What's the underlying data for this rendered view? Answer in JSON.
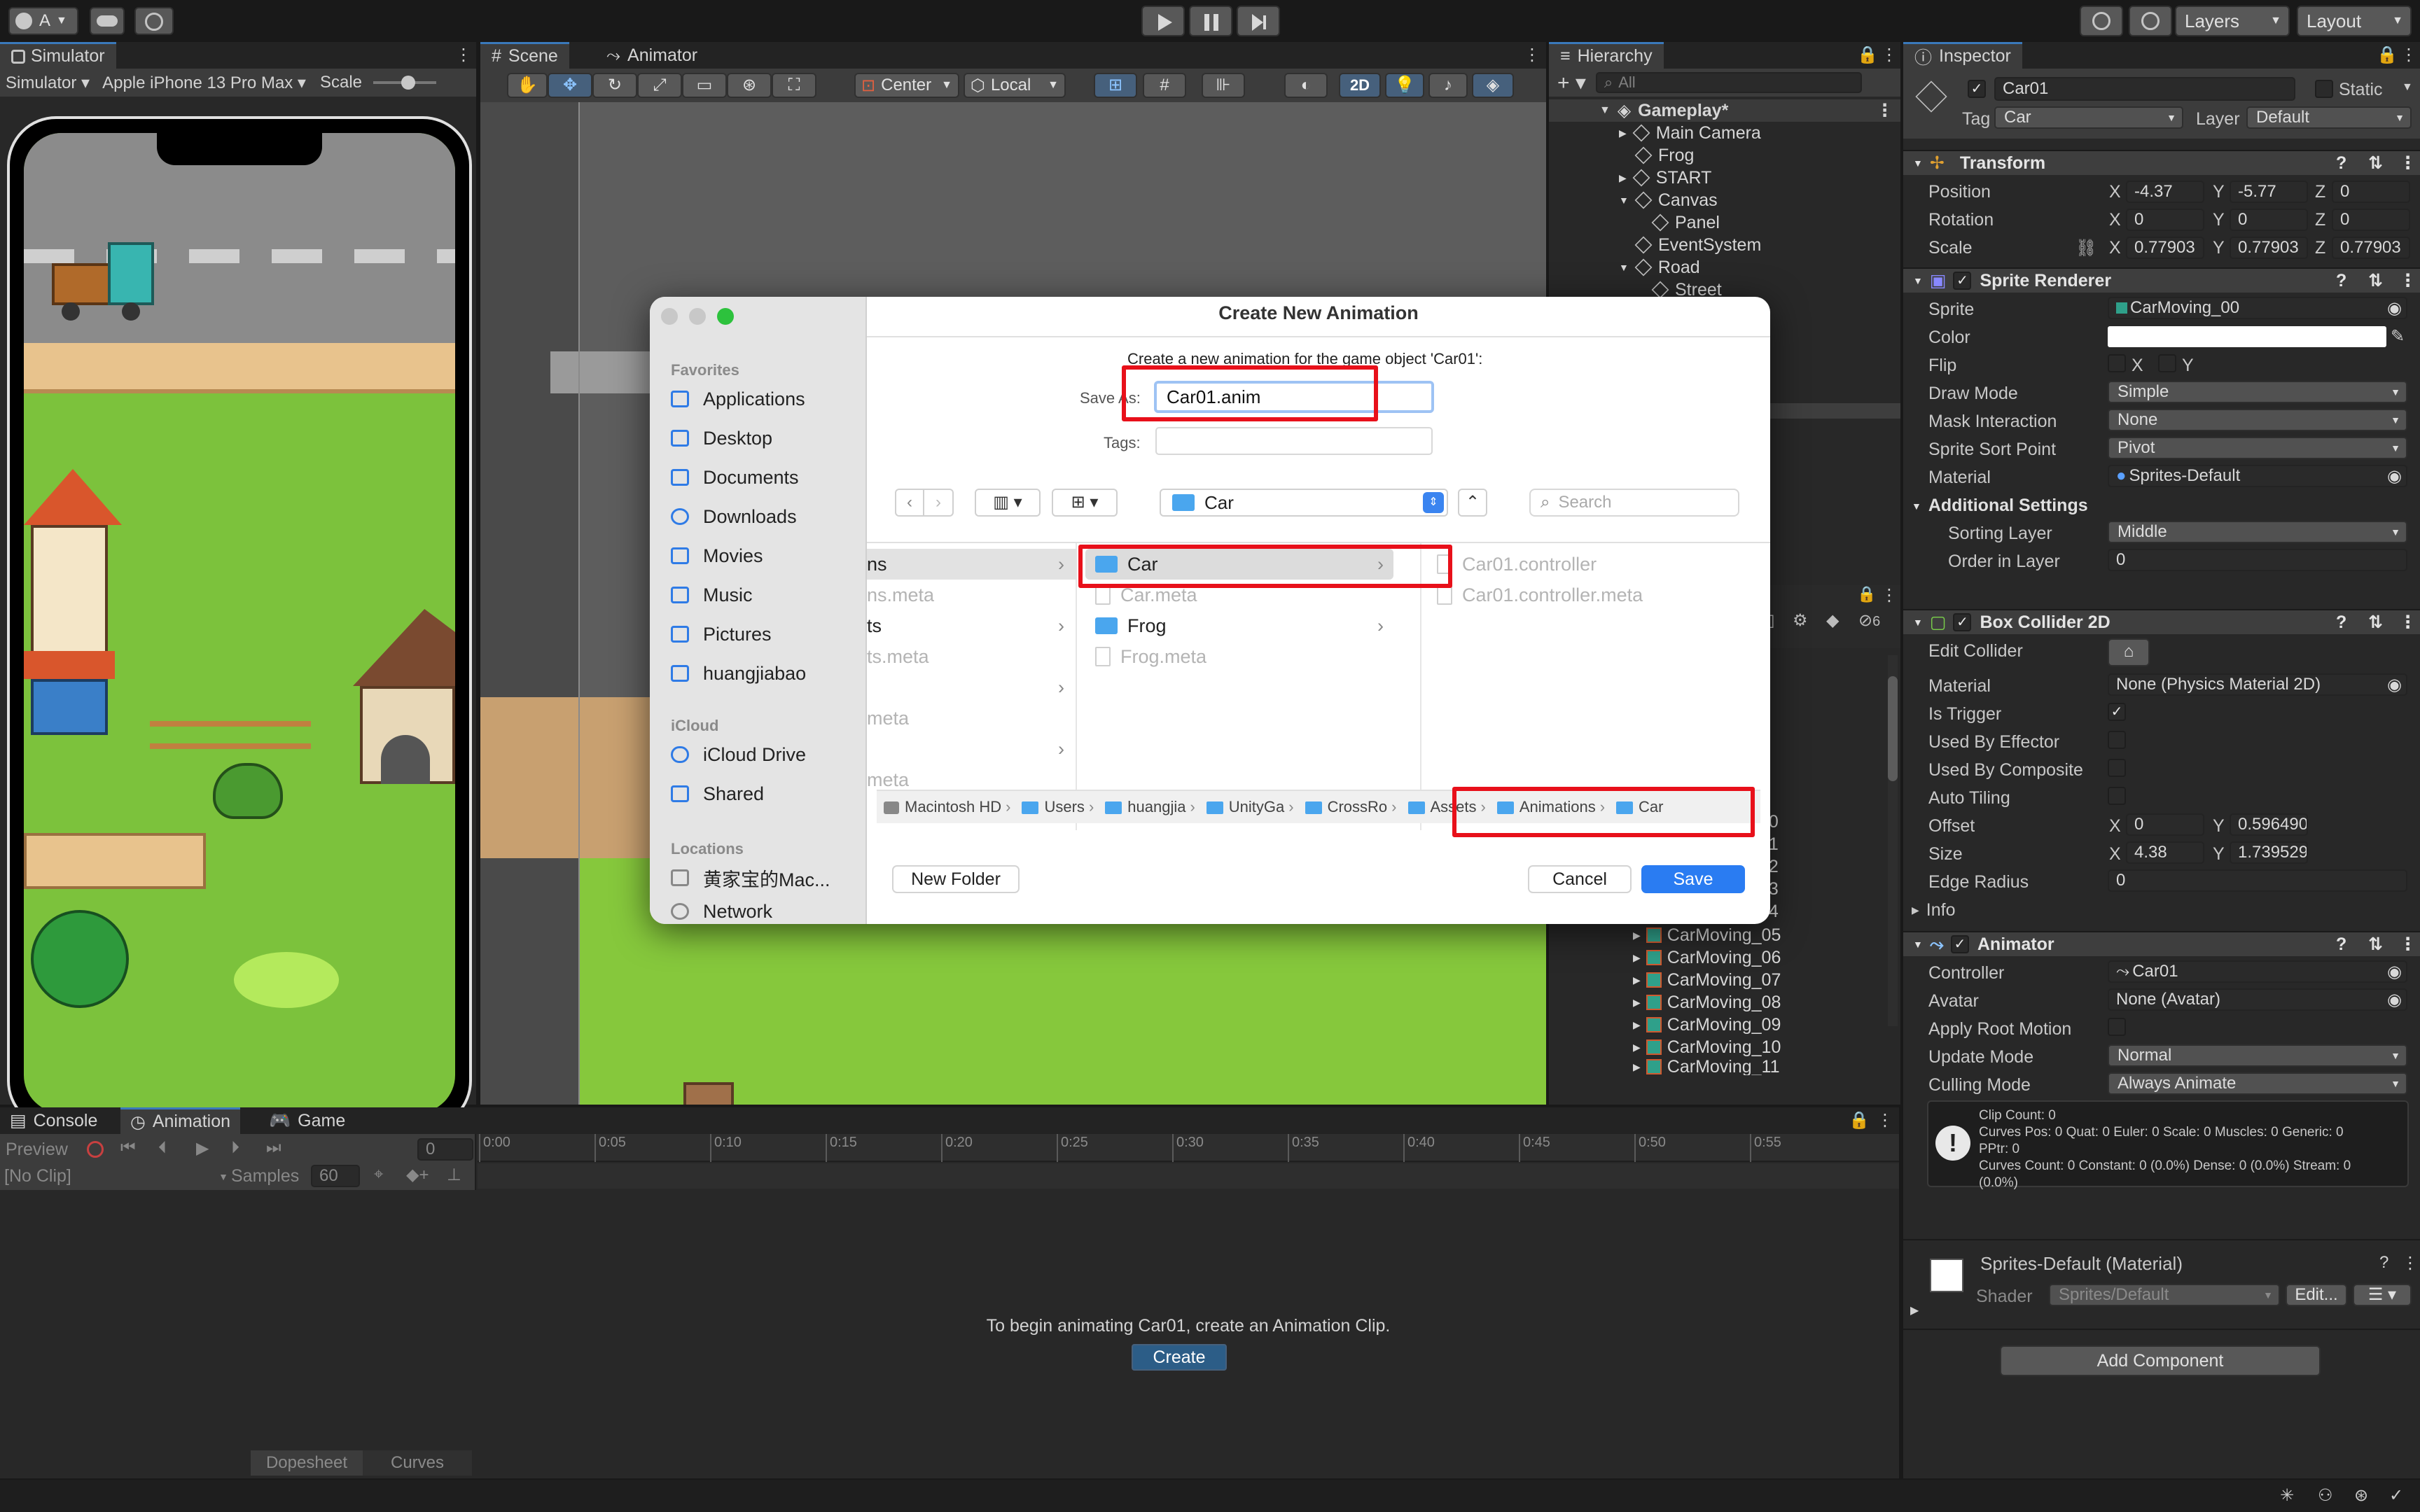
{
  "topbar": {
    "account": "A",
    "layers": "Layers",
    "layout": "Layout"
  },
  "simulator": {
    "tab": "Simulator",
    "mode": "Simulator",
    "device": "Apple iPhone 13 Pro Max",
    "scale_label": "Scale"
  },
  "scene": {
    "tab_scene": "Scene",
    "tab_animator": "Animator",
    "pivot": "Center",
    "space": "Local",
    "mode_2d": "2D"
  },
  "hierarchy": {
    "tab": "Hierarchy",
    "search_placeholder": "All",
    "root": "Gameplay*",
    "items": [
      "Main Camera",
      "Frog",
      "START",
      "Canvas",
      "Panel",
      "EventSystem",
      "Road",
      "Street"
    ],
    "carmoving": [
      "CarMoving_05",
      "CarMoving_06",
      "CarMoving_07",
      "CarMoving_08",
      "CarMoving_09",
      "CarMoving_10",
      "CarMoving_11"
    ],
    "partial": [
      "00",
      "01",
      "02",
      "03",
      "04"
    ],
    "hidden_count": "6"
  },
  "inspector": {
    "tab": "Inspector",
    "name": "Car01",
    "static": "Static",
    "tag_label": "Tag",
    "tag": "Car",
    "layer_label": "Layer",
    "layer": "Default",
    "transform": {
      "title": "Transform",
      "position": "Position",
      "rotation": "Rotation",
      "scale": "Scale",
      "px": "-4.37",
      "py": "-5.77",
      "pz": "0",
      "rx": "0",
      "ry": "0",
      "rz": "0",
      "sx": "0.77903",
      "sy": "0.77903",
      "sz": "0.77903"
    },
    "sprite": {
      "title": "Sprite Renderer",
      "sprite_label": "Sprite",
      "sprite": "CarMoving_00",
      "color": "Color",
      "flip": "Flip",
      "x": "X",
      "y": "Y",
      "draw_mode_label": "Draw Mode",
      "draw_mode": "Simple",
      "mask_label": "Mask Interaction",
      "mask": "None",
      "sort_point_label": "Sprite Sort Point",
      "sort_point": "Pivot",
      "material_label": "Material",
      "material": "Sprites-Default",
      "additional": "Additional Settings",
      "sorting_layer_label": "Sorting Layer",
      "sorting_layer": "Middle",
      "order_label": "Order in Layer",
      "order": "0"
    },
    "collider": {
      "title": "Box Collider 2D",
      "edit": "Edit Collider",
      "material_label": "Material",
      "material": "None (Physics Material 2D)",
      "trigger": "Is Trigger",
      "effector": "Used By Effector",
      "composite": "Used By Composite",
      "auto_tiling": "Auto Tiling",
      "offset": "Offset",
      "ox": "0",
      "oy": "0.596490",
      "size": "Size",
      "sx": "4.38",
      "sy": "1.739529",
      "edge": "Edge Radius",
      "edge_val": "0",
      "info": "Info"
    },
    "animator": {
      "title": "Animator",
      "controller_label": "Controller",
      "controller": "Car01",
      "avatar_label": "Avatar",
      "avatar": "None (Avatar)",
      "root_motion": "Apply Root Motion",
      "update_label": "Update Mode",
      "update": "Normal",
      "culling_label": "Culling Mode",
      "culling": "Always Animate",
      "info1": "Clip Count: 0",
      "info2": "Curves Pos: 0 Quat: 0 Euler: 0 Scale: 0 Muscles: 0 Generic: 0",
      "info3": "PPtr: 0",
      "info4": "Curves Count: 0 Constant: 0 (0.0%) Dense: 0 (0.0%) Stream: 0",
      "info5": "(0.0%)"
    },
    "material": {
      "title": "Sprites-Default (Material)",
      "shader_label": "Shader",
      "shader": "Sprites/Default",
      "edit": "Edit..."
    },
    "add_component": "Add Component"
  },
  "bottom": {
    "tab_console": "Console",
    "tab_animation": "Animation",
    "tab_game": "Game",
    "preview": "Preview",
    "frame": "0",
    "clip": "[No Clip]",
    "samples_label": "Samples",
    "samples": "60",
    "ticks": [
      "0:00",
      "0:05",
      "0:10",
      "0:15",
      "0:20",
      "0:25",
      "0:30",
      "0:35",
      "0:40",
      "0:45",
      "0:50",
      "0:55"
    ],
    "message": "To begin animating Car01, create an Animation Clip.",
    "create": "Create",
    "dopesheet": "Dopesheet",
    "curves": "Curves"
  },
  "dialog": {
    "title": "Create New Animation",
    "subtitle": "Create a new animation for the game object 'Car01':",
    "save_as_label": "Save As:",
    "filename": "Car01.anim",
    "tags_label": "Tags:",
    "location": "Car",
    "search_placeholder": "Search",
    "sidebar": {
      "favorites": "Favorites",
      "fav_items": [
        "Applications",
        "Desktop",
        "Documents",
        "Downloads",
        "Movies",
        "Music",
        "Pictures",
        "huangjiabao"
      ],
      "icloud": "iCloud",
      "icloud_items": [
        "iCloud Drive",
        "Shared"
      ],
      "locations": "Locations",
      "loc_items": [
        "黄家宝的Mac...",
        "Network"
      ]
    },
    "col1": [
      "ns",
      "ns.meta",
      "ts",
      "ts.meta",
      "",
      "meta",
      "",
      "meta"
    ],
    "col2": [
      "Car",
      "Car.meta",
      "Frog",
      "Frog.meta"
    ],
    "col3": [
      "Car01.controller",
      "Car01.controller.meta"
    ],
    "path": [
      "Macintosh HD",
      "Users",
      "huangjia",
      "UnityGa",
      "CrossRo",
      "Assets",
      "Animations",
      "Car"
    ],
    "new_folder": "New Folder",
    "cancel": "Cancel",
    "save": "Save"
  }
}
